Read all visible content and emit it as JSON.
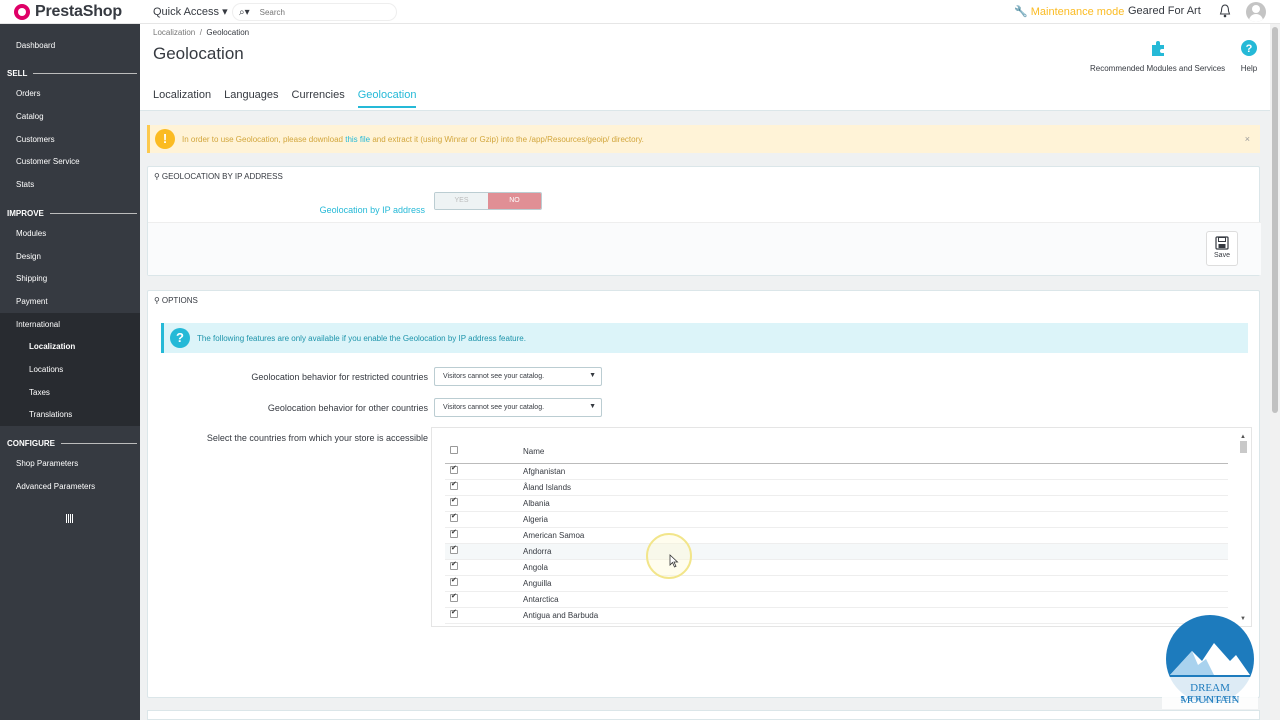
{
  "header": {
    "logo_text": "PrestaShop",
    "quick_access": "Quick Access",
    "search_placeholder": "Search",
    "maintenance_mode": "Maintenance mode",
    "shop_name": "Geared For Art"
  },
  "sidebar": {
    "dashboard": "Dashboard",
    "sell_section": "SELL",
    "sell_items": [
      "Orders",
      "Catalog",
      "Customers",
      "Customer Service",
      "Stats"
    ],
    "improve_section": "IMPROVE",
    "improve_items": [
      "Modules",
      "Design",
      "Shipping",
      "Payment",
      "International"
    ],
    "international_sub": [
      "Localization",
      "Locations",
      "Taxes",
      "Translations"
    ],
    "configure_section": "CONFIGURE",
    "configure_items": [
      "Shop Parameters",
      "Advanced Parameters"
    ]
  },
  "breadcrumb": {
    "parent": "Localization",
    "separator": "/",
    "current": "Geolocation"
  },
  "page_title": "Geolocation",
  "toolbar": {
    "recommended": "Recommended Modules and Services",
    "help": "Help"
  },
  "tabs": [
    "Localization",
    "Languages",
    "Currencies",
    "Geolocation"
  ],
  "warning": {
    "before_link": "In order to use Geolocation, please download ",
    "link": "this file",
    "after_link": " and extract it (using Winrar or Gzip) into the /app/Resources/geoip/ directory.",
    "close": "×"
  },
  "geo_panel": {
    "heading": "GEOLOCATION BY IP ADDRESS",
    "field_label": "Geolocation by IP address",
    "yes": "YES",
    "no": "NO",
    "save": "Save"
  },
  "options_panel": {
    "heading": "OPTIONS",
    "info": "The following features are only available if you enable the Geolocation by IP address feature.",
    "restricted_label": "Geolocation behavior for restricted countries",
    "restricted_value": "Visitors cannot see your catalog.",
    "other_label": "Geolocation behavior for other countries",
    "other_value": "Visitors cannot see your catalog.",
    "countries_label": "Select the countries from which your store is accessible",
    "name_header": "Name",
    "countries": [
      "Afghanistan",
      "Åland Islands",
      "Albania",
      "Algeria",
      "American Samoa",
      "Andorra",
      "Angola",
      "Anguilla",
      "Antarctica",
      "Antigua and Barbuda"
    ]
  },
  "watermark": {
    "line1": "DREAM MOUNTAIN",
    "line2": "SERVICES"
  },
  "colors": {
    "accent": "#25b9d7",
    "sidebar": "#363a41",
    "warning": "#fbbb22",
    "no_active": "#e08f95"
  }
}
